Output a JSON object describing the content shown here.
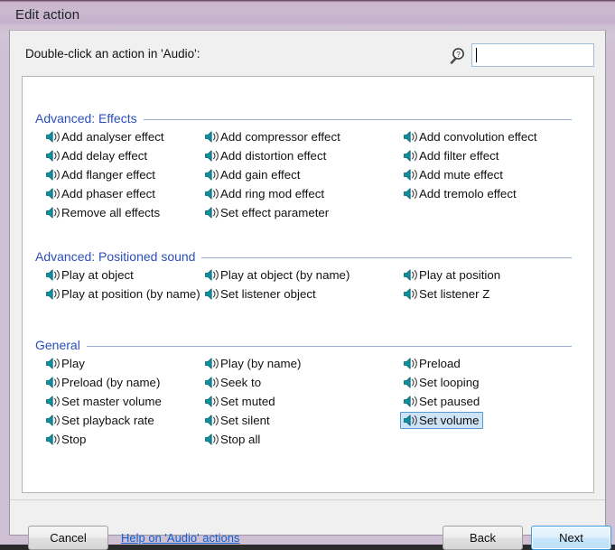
{
  "window": {
    "title": "Edit action",
    "prompt": "Double-click an action in 'Audio':"
  },
  "search": {
    "icon": "magnifier-question-icon",
    "value": "",
    "placeholder": ""
  },
  "colors": {
    "titlebar": "#cbbacf",
    "section_heading": "#2a4fbb",
    "selection_bg": "#cfe3f7",
    "selection_border": "#5a9ad6",
    "icon_teal": "#0d8fa0",
    "link": "#1060d0",
    "default_button_border": "#3c9cdb"
  },
  "sections": [
    {
      "title": "Advanced: Effects",
      "columns": [
        [
          "Add analyser effect",
          "Add delay effect",
          "Add flanger effect",
          "Add phaser effect",
          "Remove all effects"
        ],
        [
          "Add compressor effect",
          "Add distortion effect",
          "Add gain effect",
          "Add ring mod effect",
          "Set effect parameter"
        ],
        [
          "Add convolution effect",
          "Add filter effect",
          "Add mute effect",
          "Add tremolo effect"
        ]
      ]
    },
    {
      "title": "Advanced: Positioned sound",
      "columns": [
        [
          "Play at object",
          "Play at position (by name)"
        ],
        [
          "Play at object (by name)",
          "Set listener object"
        ],
        [
          "Play at position",
          "Set listener Z"
        ]
      ]
    },
    {
      "title": "General",
      "columns": [
        [
          "Play",
          "Preload (by name)",
          "Set master volume",
          "Set playback rate",
          "Stop"
        ],
        [
          "Play (by name)",
          "Seek to",
          "Set muted",
          "Set silent",
          "Stop all"
        ],
        [
          "Preload",
          "Set looping",
          "Set paused",
          "Set volume",
          ""
        ]
      ]
    }
  ],
  "selected_action": "Set volume",
  "footer": {
    "cancel_label": "Cancel",
    "help_label": "Help on 'Audio' actions",
    "back_label": "Back",
    "next_label": "Next"
  }
}
